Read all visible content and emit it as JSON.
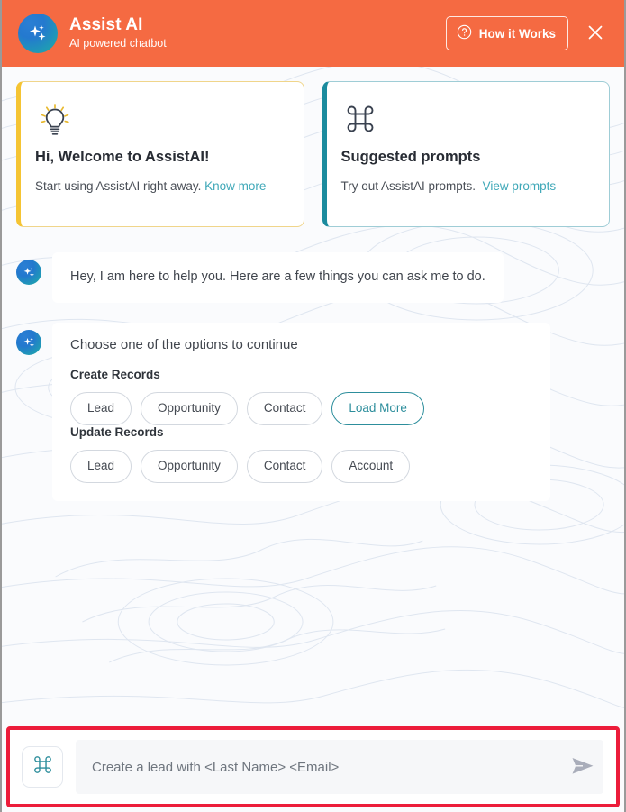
{
  "header": {
    "title": "Assist AI",
    "subtitle": "AI powered chatbot",
    "how_it_works_label": "How it Works",
    "logo_icon": "sparkle-logo-icon",
    "help_icon": "question-circle-icon",
    "close_icon": "close-icon",
    "background_color": "#f56a42"
  },
  "cards": [
    {
      "icon": "lightbulb-icon",
      "title": "Hi, Welcome to AssistAI!",
      "desc": "Start using AssistAI right away.",
      "link": "Know more",
      "accent_color": "#f5c433"
    },
    {
      "icon": "command-icon",
      "title": "Suggested prompts",
      "desc": "Try out AssistAI prompts.",
      "link": "View prompts",
      "accent_color": "#1b8b9e"
    }
  ],
  "messages": [
    {
      "avatar_icon": "sparkle-avatar-icon",
      "text": "Hey, I am here to help you. Here are a few things you can ask me to do."
    }
  ],
  "options_panel": {
    "avatar_icon": "sparkle-avatar-icon",
    "title": "Choose one of the options to continue",
    "groups": [
      {
        "label": "Create Records",
        "chips": [
          {
            "label": "Lead",
            "accent": false
          },
          {
            "label": "Opportunity",
            "accent": false
          },
          {
            "label": "Contact",
            "accent": false
          },
          {
            "label": "Load More",
            "accent": true
          }
        ]
      },
      {
        "label": "Update Records",
        "chips": [
          {
            "label": "Lead",
            "accent": false
          },
          {
            "label": "Opportunity",
            "accent": false
          },
          {
            "label": "Contact",
            "accent": false
          },
          {
            "label": "Account",
            "accent": false
          }
        ]
      }
    ]
  },
  "composer": {
    "command_icon": "command-icon",
    "placeholder": "Create a lead with <Last Name> <Email>",
    "value": "",
    "send_icon": "send-paper-plane-icon",
    "highlight_color": "#ec1c3a"
  }
}
